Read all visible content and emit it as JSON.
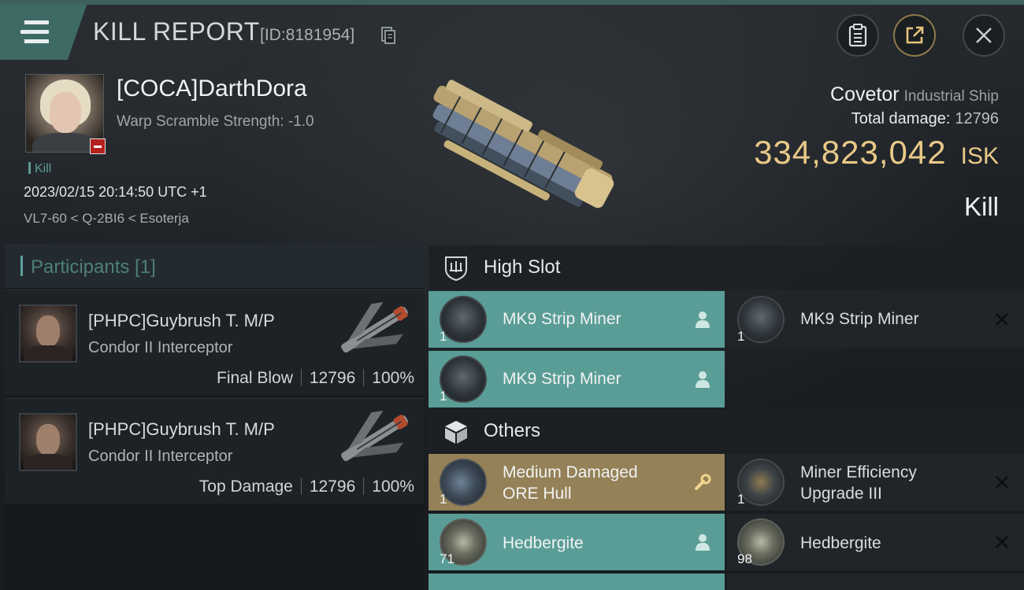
{
  "header": {
    "title": "KILL REPORT",
    "report_id": "[ID:8181954]",
    "buttons": [
      "clipboard-icon",
      "share-icon",
      "close-icon"
    ]
  },
  "victim": {
    "name": "[COCA]DarthDora",
    "warp_scramble": "Warp Scramble Strength: -1.0",
    "kill_tag": "Kill",
    "datetime": "2023/02/15 20:14:50 UTC +1",
    "location": "VL7-60 < Q-2BI6 < Esoterja",
    "ship_name": "Covetor",
    "ship_class": "Industrial Ship",
    "damage_label": "Total damage:",
    "damage_value": "12796",
    "isk_value": "334,823,042",
    "isk_unit": "ISK",
    "result": "Kill"
  },
  "participants": {
    "header": "Participants [1]",
    "rows": [
      {
        "name": "[PHPC]Guybrush T. M/P",
        "ship": "Condor II Interceptor",
        "role": "Final Blow",
        "damage": "12796",
        "percent": "100%"
      },
      {
        "name": "[PHPC]Guybrush T. M/P",
        "ship": "Condor II Interceptor",
        "role": "Top Damage",
        "damage": "12796",
        "percent": "100%"
      }
    ]
  },
  "fitting": {
    "high_slot": {
      "label": "High Slot",
      "items": [
        {
          "name": "MK9 Strip Miner",
          "qty": "1",
          "state": "dropped"
        },
        {
          "name": "MK9 Strip Miner",
          "qty": "1",
          "state": "destroyed"
        },
        {
          "name": "MK9 Strip Miner",
          "qty": "1",
          "state": "dropped"
        }
      ]
    },
    "others": {
      "label": "Others",
      "items": [
        {
          "name_line1": "Medium Damaged",
          "name_line2": "ORE Hull",
          "qty": "1",
          "state": "damaged"
        },
        {
          "name_line1": "Miner Efficiency",
          "name_line2": "Upgrade III",
          "qty": "1",
          "state": "destroyed"
        },
        {
          "name": "Hedbergite",
          "qty": "71",
          "state": "dropped"
        },
        {
          "name": "Hedbergite",
          "qty": "98",
          "state": "destroyed"
        }
      ]
    }
  },
  "colors": {
    "accent_teal": "#5a9d96",
    "accent_gold": "#e9c987",
    "damaged_gold": "#958157"
  }
}
